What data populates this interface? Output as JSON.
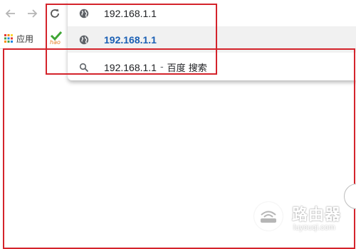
{
  "toolbar": {
    "back_icon": "arrow-left-icon",
    "forward_icon": "arrow-right-icon",
    "reload_icon": "reload-icon"
  },
  "bookmarks": {
    "apps_label": "应用",
    "apps_icon": "apps-grid-icon",
    "hao_icon": "hao123-icon"
  },
  "omnibox": {
    "suggestions": [
      {
        "icon": "globe-icon",
        "text": "192.168.1.1",
        "suffix": "",
        "selected": false
      },
      {
        "icon": "globe-icon",
        "text": "192.168.1.1",
        "suffix": "",
        "selected": true
      },
      {
        "icon": "search-icon",
        "text": "192.168.1.1",
        "separator": "-",
        "suffix": "百度 搜索",
        "selected": false
      }
    ]
  },
  "watermark": {
    "title": "路由器",
    "url": "luyouqi.com"
  },
  "colors": {
    "annotation_red": "#d4232b",
    "selected_text": "#1a5fb4",
    "selected_row_bg": "#f1f1f1"
  }
}
